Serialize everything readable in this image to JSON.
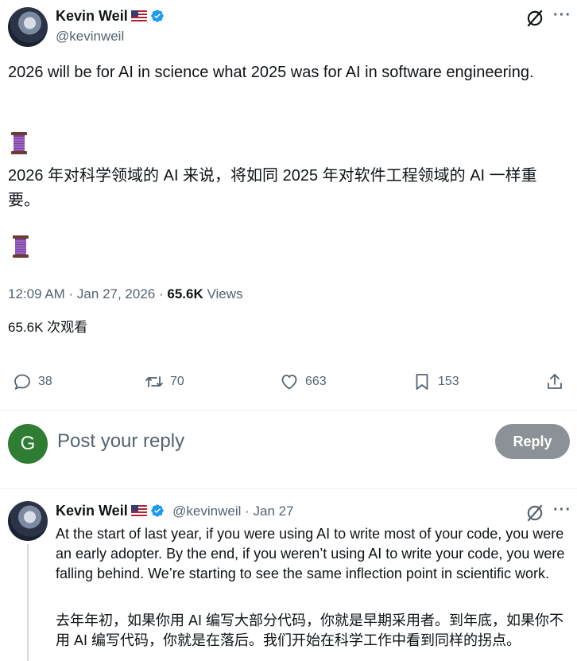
{
  "tweet": {
    "author_name": "Kevin Weil",
    "author_handle": "@kevinweil",
    "text_en": "2026 will be for AI in science what 2025 was for AI in software engineering.",
    "text_zh": "2026 年对科学领域的 AI 来说，将如同 2025 年对软件工程领域的 AI 一样重要。",
    "timestamp": "12:09 AM · Jan 27, 2026 · ",
    "views_count": "65.6K",
    "views_label": " Views",
    "views_zh": "65.6K 次观看"
  },
  "actions": {
    "replies": "38",
    "retweets": "70",
    "likes": "663",
    "bookmarks": "153"
  },
  "composer": {
    "avatar_letter": "G",
    "placeholder": "Post your reply",
    "button_label": "Reply"
  },
  "reply_tweet": {
    "author_name": "Kevin Weil",
    "author_handle": "@kevinweil",
    "date": " · Jan 27",
    "text_en": "At the start of last year, if you were using AI to write most of your code, you were an early adopter. By the end, if you weren’t using AI to write your code, you were falling behind. We’re starting to see the same inflection point in scientific work.",
    "text_zh": "去年年初，如果你用 AI 编写大部分代码，你就是早期采用者。到年底，如果你不用 AI 编写代码，你就是在落后。我们开始在科学工作中看到同样的拐点。"
  },
  "icons": {
    "more": "more-icon",
    "grok": "grok-icon",
    "spool": "thread-spool-emoji"
  },
  "colors": {
    "verified": "#1d9bf0",
    "reply_button": "#8b9196",
    "avatar_g": "#2e7d32"
  }
}
